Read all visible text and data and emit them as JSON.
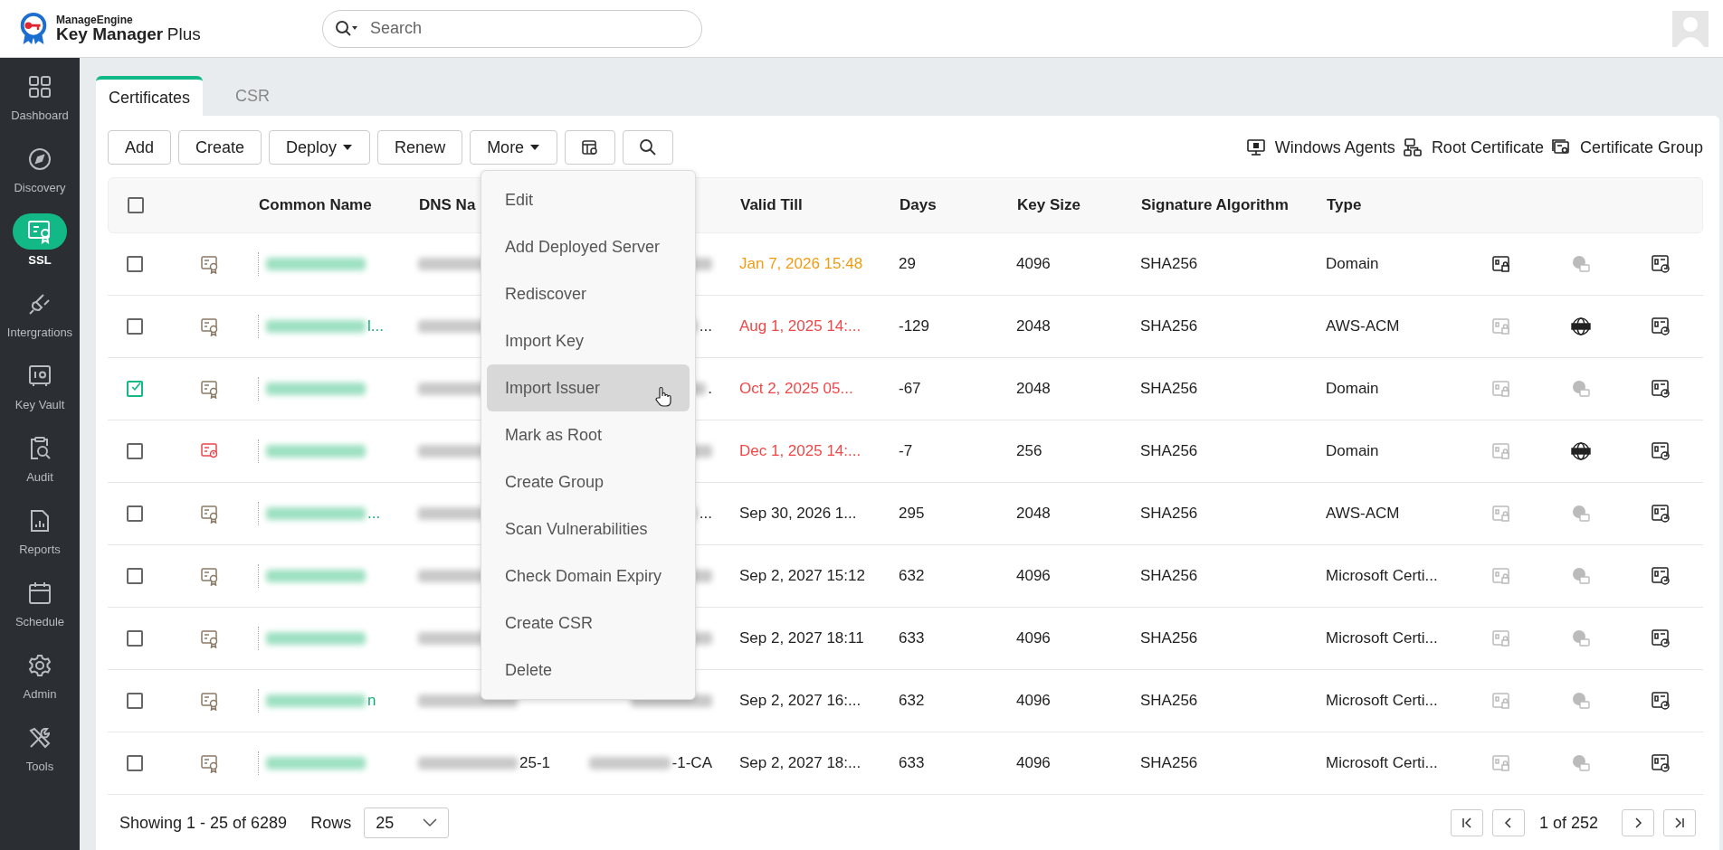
{
  "header": {
    "brand_top": "ManageEngine",
    "brand_bottom": "Key Manager",
    "brand_suffix": "Plus",
    "search": {
      "placeholder": "Search"
    }
  },
  "sidebar": {
    "items": [
      {
        "kind": "dashboard",
        "label": "Dashboard",
        "selected": false
      },
      {
        "kind": "discovery",
        "label": "Discovery",
        "selected": false
      },
      {
        "kind": "ssl",
        "label": "SSL",
        "selected": true
      },
      {
        "kind": "plug",
        "label": "Intergrations",
        "selected": false
      },
      {
        "kind": "vault",
        "label": "Key Vault",
        "selected": false
      },
      {
        "kind": "audit",
        "label": "Audit",
        "selected": false
      },
      {
        "kind": "reports",
        "label": "Reports",
        "selected": false
      },
      {
        "kind": "schedule",
        "label": "Schedule",
        "selected": false
      },
      {
        "kind": "admin",
        "label": "Admin",
        "selected": false
      },
      {
        "kind": "tools",
        "label": "Tools",
        "selected": false
      }
    ]
  },
  "tabs": [
    {
      "label": "Certificates",
      "selected": true
    },
    {
      "label": "CSR",
      "selected": false
    }
  ],
  "toolbar": {
    "buttons": [
      {
        "label": "Add",
        "dropdown": false
      },
      {
        "label": "Create",
        "dropdown": false
      },
      {
        "label": "Deploy",
        "dropdown": true
      },
      {
        "label": "Renew",
        "dropdown": false
      },
      {
        "label": "More",
        "dropdown": true
      }
    ],
    "links": [
      {
        "kind": "monitor",
        "label": "Windows Agents"
      },
      {
        "kind": "tree",
        "label": "Root Certificate"
      },
      {
        "kind": "group",
        "label": "Certificate Group"
      }
    ]
  },
  "table": {
    "select_all_checked": false,
    "columns": [
      "Common Name",
      "DNS Na",
      "Valid Till",
      "Days",
      "Key Size",
      "Signature Algorithm",
      "Type"
    ],
    "rows": [
      {
        "checked": false,
        "cert_alert": false,
        "valid_till": "Jan 7, 2026 15:48",
        "expired": false,
        "expiring_soon": true,
        "days": "29",
        "key_size": "4096",
        "algorithm": "SHA256",
        "type": "Domain",
        "lock_enabled": true,
        "dns_enabled": false
      },
      {
        "checked": false,
        "cert_alert": false,
        "name_tail": "l...",
        "col3_tail": "...",
        "valid_till": "Aug 1, 2025 14:...",
        "expired": true,
        "expiring_soon": false,
        "days": "-129",
        "key_size": "2048",
        "algorithm": "SHA256",
        "type": "AWS-ACM",
        "lock_enabled": false,
        "dns_enabled": true
      },
      {
        "checked": true,
        "cert_alert": false,
        "col3_tail": ".",
        "valid_till": "Oct 2, 2025 05...",
        "expired": true,
        "expiring_soon": false,
        "days": "-67",
        "key_size": "2048",
        "algorithm": "SHA256",
        "type": "Domain",
        "lock_enabled": false,
        "dns_enabled": false
      },
      {
        "checked": false,
        "cert_alert": true,
        "valid_till": "Dec 1, 2025 14:...",
        "expired": true,
        "expiring_soon": false,
        "days": "-7",
        "key_size": "256",
        "algorithm": "SHA256",
        "type": "Domain",
        "lock_enabled": false,
        "dns_enabled": true
      },
      {
        "checked": false,
        "cert_alert": false,
        "name_tail": "...",
        "col3_tail": "...",
        "valid_till": "Sep 30, 2026 1...",
        "expired": false,
        "expiring_soon": false,
        "days": "295",
        "key_size": "2048",
        "algorithm": "SHA256",
        "type": "AWS-ACM",
        "lock_enabled": false,
        "dns_enabled": false
      },
      {
        "checked": false,
        "cert_alert": false,
        "valid_till": "Sep 2, 2027 15:12",
        "expired": false,
        "expiring_soon": false,
        "days": "632",
        "key_size": "4096",
        "algorithm": "SHA256",
        "type": "Microsoft Certi...",
        "lock_enabled": false,
        "dns_enabled": false
      },
      {
        "checked": false,
        "cert_alert": false,
        "valid_till": "Sep 2, 2027 18:11",
        "expired": false,
        "expiring_soon": false,
        "days": "633",
        "key_size": "4096",
        "algorithm": "SHA256",
        "type": "Microsoft Certi...",
        "lock_enabled": false,
        "dns_enabled": false
      },
      {
        "checked": false,
        "cert_alert": false,
        "name_tail": "n",
        "valid_till": "Sep 2, 2027 16:...",
        "expired": false,
        "expiring_soon": false,
        "days": "632",
        "key_size": "4096",
        "algorithm": "SHA256",
        "type": "Microsoft Certi...",
        "lock_enabled": false,
        "dns_enabled": false
      },
      {
        "checked": false,
        "cert_alert": false,
        "dns_tail": "25-1",
        "col3_tail": "-1-CA",
        "valid_till": "Sep 2, 2027 18:...",
        "expired": false,
        "expiring_soon": false,
        "days": "633",
        "key_size": "4096",
        "algorithm": "SHA256",
        "type": "Microsoft Certi...",
        "lock_enabled": false,
        "dns_enabled": false
      }
    ]
  },
  "more_menu": {
    "items": [
      {
        "label": "Edit",
        "selected": false
      },
      {
        "label": "Add Deployed Server",
        "selected": false
      },
      {
        "label": "Rediscover",
        "selected": false
      },
      {
        "label": "Import Key",
        "selected": false
      },
      {
        "label": "Import Issuer",
        "selected": true
      },
      {
        "label": "Mark as Root",
        "selected": false
      },
      {
        "label": "Create Group",
        "selected": false
      },
      {
        "label": "Scan Vulnerabilities",
        "selected": false
      },
      {
        "label": "Check Domain Expiry",
        "selected": false
      },
      {
        "label": "Create CSR",
        "selected": false
      },
      {
        "label": "Delete",
        "selected": false
      }
    ]
  },
  "footer": {
    "showing": "Showing 1 - 25 of 6289",
    "rows_label": "Rows",
    "rows_value": "25",
    "page": "1 of 252"
  }
}
